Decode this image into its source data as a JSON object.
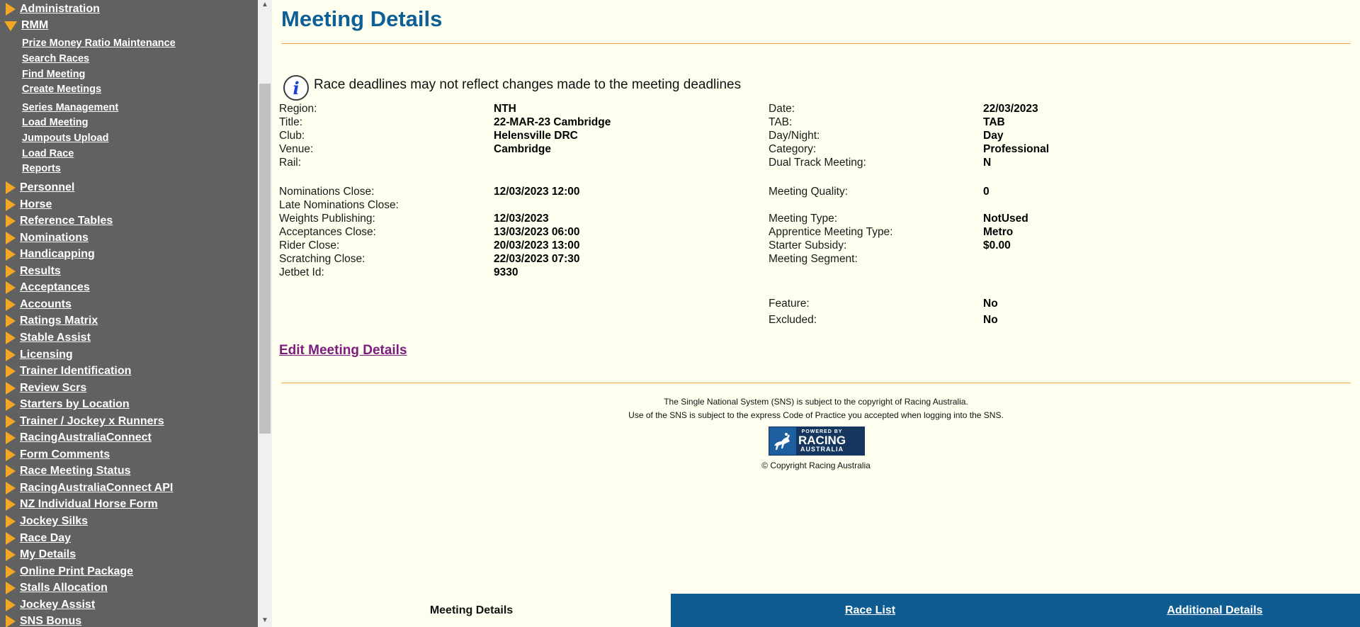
{
  "sidebar": {
    "top_items": [
      {
        "label": "Administration",
        "open": false
      },
      {
        "label": "RMM",
        "open": true
      }
    ],
    "rmm_subitems": [
      "Prize Money Ratio Maintenance",
      "Search Races",
      "Find Meeting",
      "Create Meetings",
      "Series Management",
      "Load Meeting",
      "Jumpouts Upload",
      "Load Race",
      "Reports"
    ],
    "items": [
      "Personnel",
      "Horse",
      "Reference Tables",
      "Nominations",
      "Handicapping",
      "Results",
      "Acceptances",
      "Accounts",
      "Ratings Matrix",
      "Stable Assist",
      "Licensing",
      "Trainer Identification",
      "Review Scrs",
      "Starters by Location",
      "Trainer / Jockey x Runners",
      "RacingAustraliaConnect",
      "Form Comments",
      "Race Meeting Status",
      "RacingAustraliaConnect API",
      "NZ Individual Horse Form",
      "Jockey Silks",
      "Race Day",
      "My Details",
      "Online Print Package",
      "Stalls Allocation",
      "Jockey Assist",
      "SNS Bonus"
    ]
  },
  "page": {
    "title": "Meeting Details",
    "info_message": "Race deadlines may not reflect changes made to the meeting deadlines"
  },
  "details_left": [
    {
      "label": "Region:",
      "value": "NTH"
    },
    {
      "label": "Title:",
      "value": "22-MAR-23 Cambridge"
    },
    {
      "label": "Club:",
      "value": "Helensville DRC"
    },
    {
      "label": "Venue:",
      "value": "Cambridge"
    },
    {
      "label": "Rail:",
      "value": ""
    },
    {
      "label": "Nominations Close:",
      "value": "12/03/2023 12:00"
    },
    {
      "label": "Late Nominations Close:",
      "value": ""
    },
    {
      "label": "Weights Publishing:",
      "value": "12/03/2023"
    },
    {
      "label": "Acceptances Close:",
      "value": "13/03/2023 06:00"
    },
    {
      "label": "Rider Close:",
      "value": "20/03/2023 13:00"
    },
    {
      "label": "Scratching Close:",
      "value": "22/03/2023 07:30"
    },
    {
      "label": "Jetbet Id:",
      "value": "9330"
    }
  ],
  "details_right": [
    {
      "label": "Date:",
      "value": "22/03/2023"
    },
    {
      "label": "TAB:",
      "value": "TAB"
    },
    {
      "label": "Day/Night:",
      "value": "Day"
    },
    {
      "label": "Category:",
      "value": "Professional"
    },
    {
      "label": "Dual Track Meeting:",
      "value": "N"
    },
    {
      "label": "Meeting Quality:",
      "value": "0"
    },
    {
      "label": "Meeting Type:",
      "value": "NotUsed"
    },
    {
      "label": "Apprentice Meeting Type:",
      "value": "Metro"
    },
    {
      "label": "Starter Subsidy:",
      "value": "$0.00"
    },
    {
      "label": "Meeting Segment:",
      "value": ""
    },
    {
      "label": "Feature:",
      "value": "No"
    },
    {
      "label": "Excluded:",
      "value": "No"
    }
  ],
  "edit_link": "Edit Meeting Details",
  "footer": {
    "line1": "The Single National System (SNS) is subject to the copyright of Racing Australia.",
    "line2": "Use of the SNS is subject to the express Code of Practice you accepted when logging into the SNS.",
    "logo_top": "POWERED BY",
    "logo_main": "RACING",
    "logo_bottom": "AUSTRALIA",
    "copyright": "© Copyright Racing Australia"
  },
  "tabs": [
    {
      "label": "Meeting Details",
      "active": true
    },
    {
      "label": "Race List",
      "active": false
    },
    {
      "label": "Additional Details",
      "active": false
    }
  ],
  "colors": {
    "sidebar_bg": "#616161",
    "accent_orange": "#f5a623",
    "title_blue": "#0f5f97",
    "tab_blue": "#0e5c92",
    "page_bg": "#fffff0",
    "link_purple": "#7d1b7e"
  }
}
